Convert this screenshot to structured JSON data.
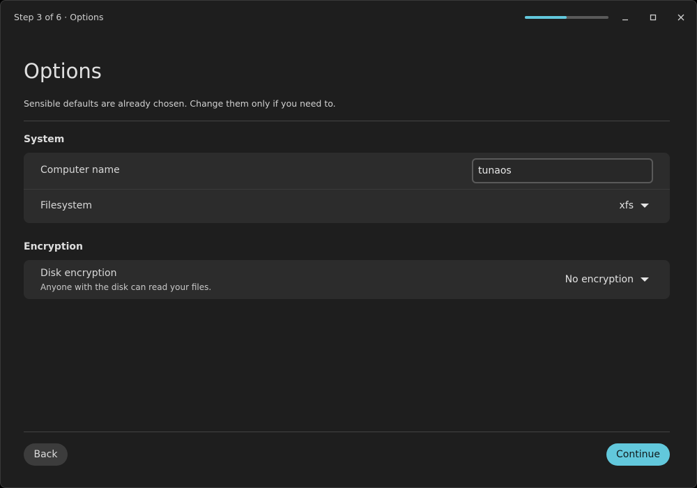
{
  "window": {
    "title": "Step 3 of 6 · Options",
    "progress_fraction": 0.5,
    "accent_color": "#62c8dc",
    "controls": [
      "minimize-icon",
      "maximize-icon",
      "close-icon"
    ]
  },
  "page": {
    "title": "Options",
    "subtitle": "Sensible defaults are already chosen. Change them only if you need to."
  },
  "system": {
    "section_title": "System",
    "computer_name_label": "Computer name",
    "computer_name_value": "tunaos",
    "filesystem_label": "Filesystem",
    "filesystem_value": "xfs"
  },
  "encryption": {
    "section_title": "Encryption",
    "disk_encryption_label": "Disk encryption",
    "disk_encryption_desc": "Anyone with the disk can read your files.",
    "disk_encryption_value": "No encryption"
  },
  "footer": {
    "back_label": "Back",
    "continue_label": "Continue"
  }
}
